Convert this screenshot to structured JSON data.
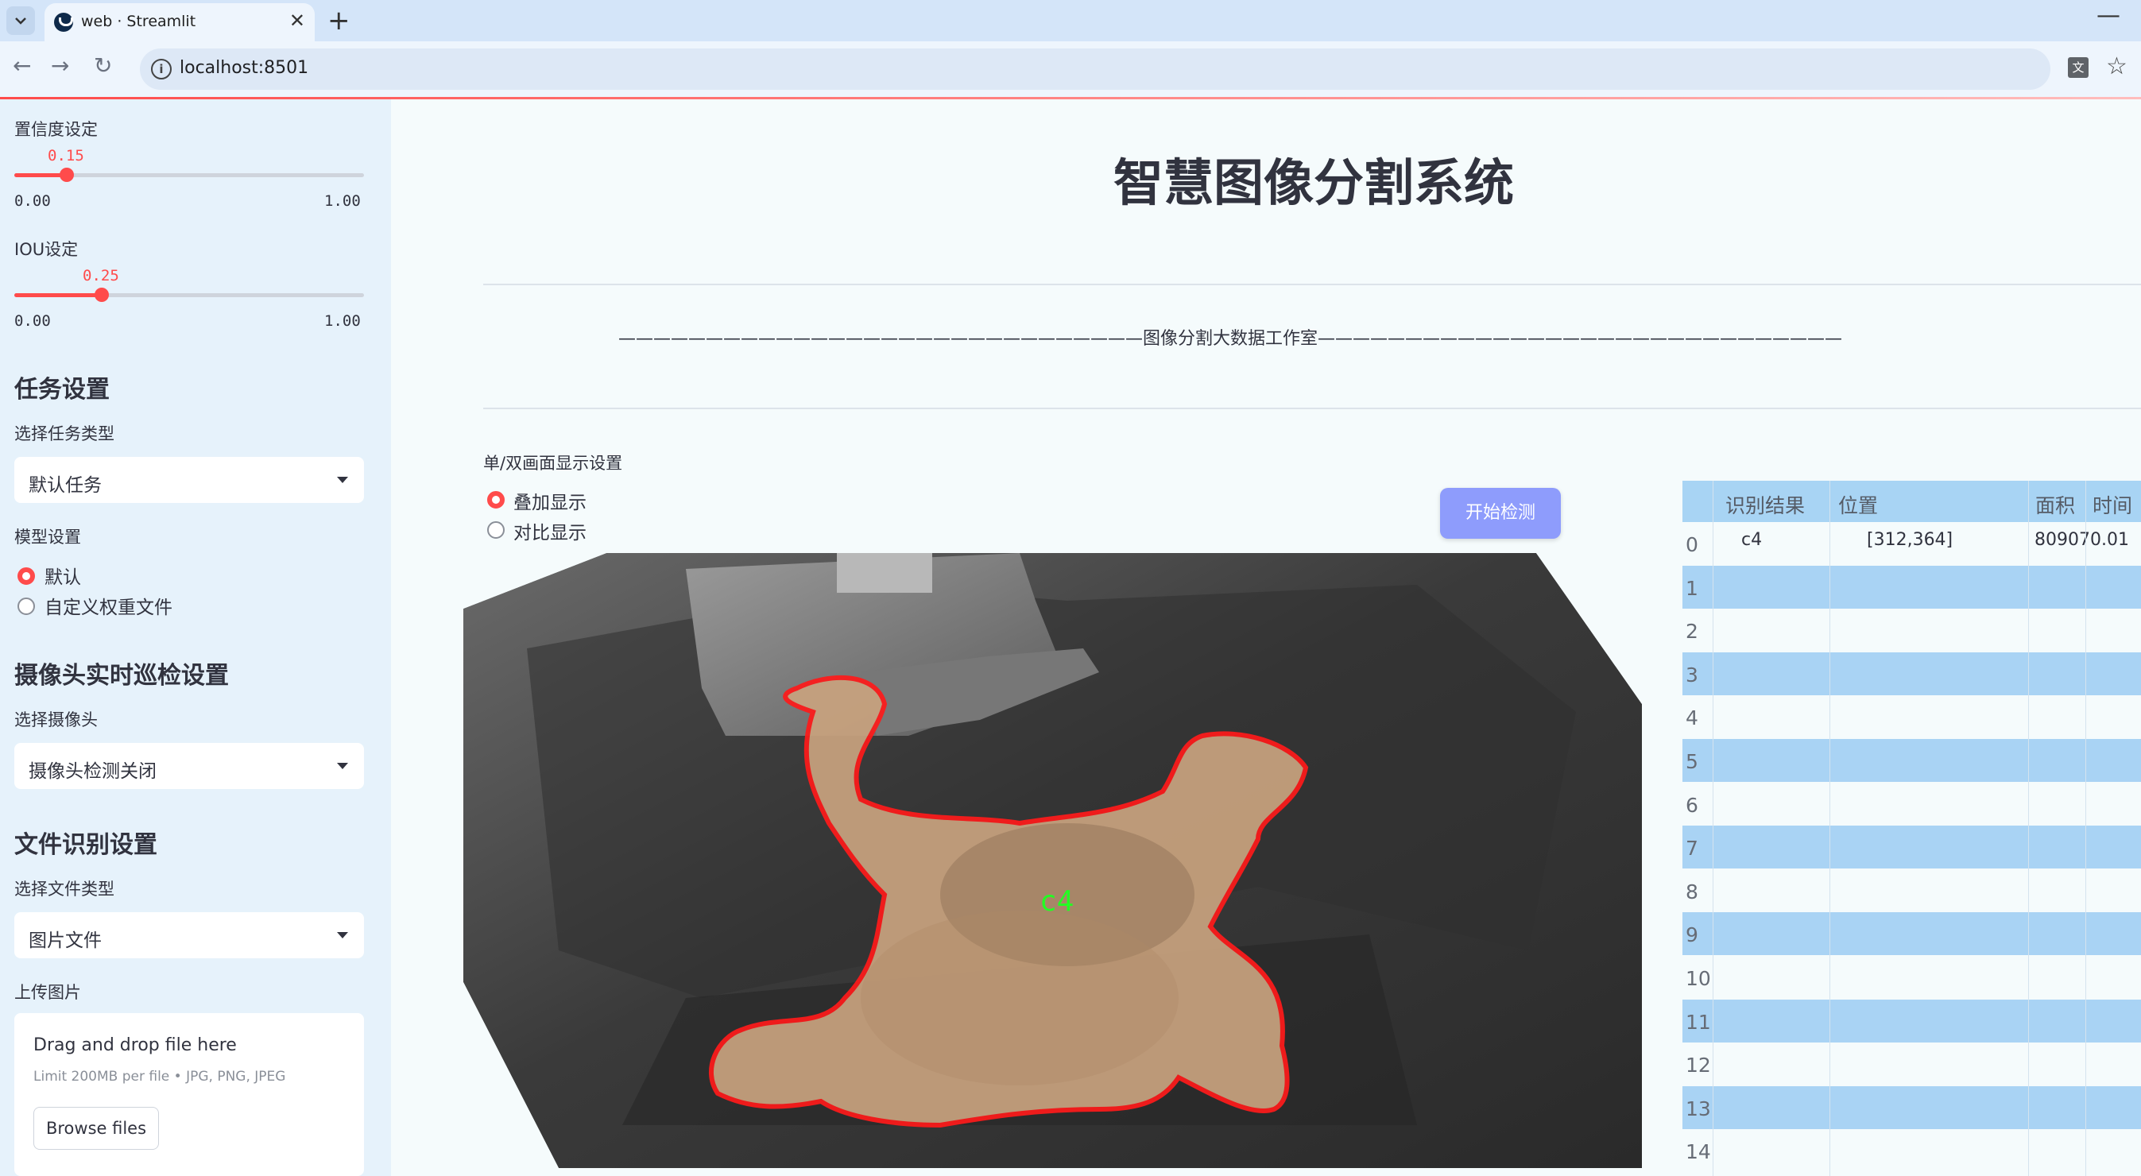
{
  "browser": {
    "tab_title": "web · Streamlit",
    "url": "localhost:8501"
  },
  "sidebar": {
    "confidence": {
      "label": "置信度设定",
      "value": "0.15",
      "value_num": 0.15,
      "min": "0.00",
      "max": "1.00"
    },
    "iou": {
      "label": "IOU设定",
      "value": "0.25",
      "value_num": 0.25,
      "min": "0.00",
      "max": "1.00"
    },
    "task": {
      "header": "任务设置",
      "label": "选择任务类型",
      "selected": "默认任务"
    },
    "model": {
      "label": "模型设置",
      "options": [
        "默认",
        "自定义权重文件"
      ],
      "selected_index": 0
    },
    "camera": {
      "header": "摄像头实时巡检设置",
      "label": "选择摄像头",
      "selected": "摄像头检测关闭"
    },
    "file": {
      "header": "文件识别设置",
      "label": "选择文件类型",
      "selected": "图片文件"
    },
    "upload": {
      "label": "上传图片",
      "title": "Drag and drop file here",
      "subtitle": "Limit 200MB per file • JPG, PNG, JPEG",
      "button": "Browse files"
    }
  },
  "main": {
    "title": "智慧图像分割系统",
    "divider_text": "——————————————————————————————图像分割大数据工作室——————————————————————————————",
    "display": {
      "label": "单/双画面显示设置",
      "options": [
        "叠加显示",
        "对比显示"
      ],
      "selected_index": 0
    },
    "start_button": "开始检测",
    "detection_label": "c4"
  },
  "table": {
    "columns": [
      "识别结果",
      "位置",
      "面积",
      "时间"
    ],
    "rows": [
      {
        "index": "0",
        "result": "c4",
        "position": "[312,364]",
        "area": "80907",
        "time": "0.01"
      },
      {
        "index": "1"
      },
      {
        "index": "2"
      },
      {
        "index": "3"
      },
      {
        "index": "4"
      },
      {
        "index": "5"
      },
      {
        "index": "6"
      },
      {
        "index": "7"
      },
      {
        "index": "8"
      },
      {
        "index": "9"
      },
      {
        "index": "10"
      },
      {
        "index": "11"
      },
      {
        "index": "12"
      },
      {
        "index": "13"
      },
      {
        "index": "14"
      }
    ]
  },
  "colors": {
    "accent": "#ff4b4b",
    "button": "#8e9cfc",
    "sidebar_bg": "#e6f2fb",
    "table_alt": "#a9d3f4"
  }
}
